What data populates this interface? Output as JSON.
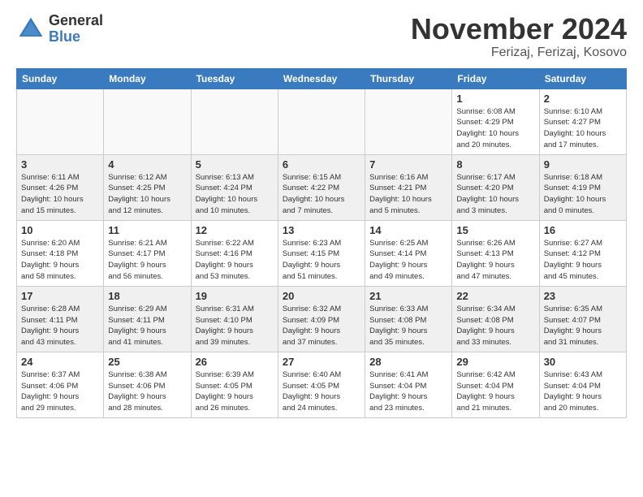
{
  "header": {
    "logo_general": "General",
    "logo_blue": "Blue",
    "month_title": "November 2024",
    "location": "Ferizaj, Ferizaj, Kosovo"
  },
  "days_of_week": [
    "Sunday",
    "Monday",
    "Tuesday",
    "Wednesday",
    "Thursday",
    "Friday",
    "Saturday"
  ],
  "weeks": [
    [
      {
        "day": "",
        "info": "",
        "empty": true
      },
      {
        "day": "",
        "info": "",
        "empty": true
      },
      {
        "day": "",
        "info": "",
        "empty": true
      },
      {
        "day": "",
        "info": "",
        "empty": true
      },
      {
        "day": "",
        "info": "",
        "empty": true
      },
      {
        "day": "1",
        "info": "Sunrise: 6:08 AM\nSunset: 4:29 PM\nDaylight: 10 hours\nand 20 minutes.",
        "empty": false
      },
      {
        "day": "2",
        "info": "Sunrise: 6:10 AM\nSunset: 4:27 PM\nDaylight: 10 hours\nand 17 minutes.",
        "empty": false
      }
    ],
    [
      {
        "day": "3",
        "info": "Sunrise: 6:11 AM\nSunset: 4:26 PM\nDaylight: 10 hours\nand 15 minutes.",
        "empty": false
      },
      {
        "day": "4",
        "info": "Sunrise: 6:12 AM\nSunset: 4:25 PM\nDaylight: 10 hours\nand 12 minutes.",
        "empty": false
      },
      {
        "day": "5",
        "info": "Sunrise: 6:13 AM\nSunset: 4:24 PM\nDaylight: 10 hours\nand 10 minutes.",
        "empty": false
      },
      {
        "day": "6",
        "info": "Sunrise: 6:15 AM\nSunset: 4:22 PM\nDaylight: 10 hours\nand 7 minutes.",
        "empty": false
      },
      {
        "day": "7",
        "info": "Sunrise: 6:16 AM\nSunset: 4:21 PM\nDaylight: 10 hours\nand 5 minutes.",
        "empty": false
      },
      {
        "day": "8",
        "info": "Sunrise: 6:17 AM\nSunset: 4:20 PM\nDaylight: 10 hours\nand 3 minutes.",
        "empty": false
      },
      {
        "day": "9",
        "info": "Sunrise: 6:18 AM\nSunset: 4:19 PM\nDaylight: 10 hours\nand 0 minutes.",
        "empty": false
      }
    ],
    [
      {
        "day": "10",
        "info": "Sunrise: 6:20 AM\nSunset: 4:18 PM\nDaylight: 9 hours\nand 58 minutes.",
        "empty": false
      },
      {
        "day": "11",
        "info": "Sunrise: 6:21 AM\nSunset: 4:17 PM\nDaylight: 9 hours\nand 56 minutes.",
        "empty": false
      },
      {
        "day": "12",
        "info": "Sunrise: 6:22 AM\nSunset: 4:16 PM\nDaylight: 9 hours\nand 53 minutes.",
        "empty": false
      },
      {
        "day": "13",
        "info": "Sunrise: 6:23 AM\nSunset: 4:15 PM\nDaylight: 9 hours\nand 51 minutes.",
        "empty": false
      },
      {
        "day": "14",
        "info": "Sunrise: 6:25 AM\nSunset: 4:14 PM\nDaylight: 9 hours\nand 49 minutes.",
        "empty": false
      },
      {
        "day": "15",
        "info": "Sunrise: 6:26 AM\nSunset: 4:13 PM\nDaylight: 9 hours\nand 47 minutes.",
        "empty": false
      },
      {
        "day": "16",
        "info": "Sunrise: 6:27 AM\nSunset: 4:12 PM\nDaylight: 9 hours\nand 45 minutes.",
        "empty": false
      }
    ],
    [
      {
        "day": "17",
        "info": "Sunrise: 6:28 AM\nSunset: 4:11 PM\nDaylight: 9 hours\nand 43 minutes.",
        "empty": false
      },
      {
        "day": "18",
        "info": "Sunrise: 6:29 AM\nSunset: 4:11 PM\nDaylight: 9 hours\nand 41 minutes.",
        "empty": false
      },
      {
        "day": "19",
        "info": "Sunrise: 6:31 AM\nSunset: 4:10 PM\nDaylight: 9 hours\nand 39 minutes.",
        "empty": false
      },
      {
        "day": "20",
        "info": "Sunrise: 6:32 AM\nSunset: 4:09 PM\nDaylight: 9 hours\nand 37 minutes.",
        "empty": false
      },
      {
        "day": "21",
        "info": "Sunrise: 6:33 AM\nSunset: 4:08 PM\nDaylight: 9 hours\nand 35 minutes.",
        "empty": false
      },
      {
        "day": "22",
        "info": "Sunrise: 6:34 AM\nSunset: 4:08 PM\nDaylight: 9 hours\nand 33 minutes.",
        "empty": false
      },
      {
        "day": "23",
        "info": "Sunrise: 6:35 AM\nSunset: 4:07 PM\nDaylight: 9 hours\nand 31 minutes.",
        "empty": false
      }
    ],
    [
      {
        "day": "24",
        "info": "Sunrise: 6:37 AM\nSunset: 4:06 PM\nDaylight: 9 hours\nand 29 minutes.",
        "empty": false
      },
      {
        "day": "25",
        "info": "Sunrise: 6:38 AM\nSunset: 4:06 PM\nDaylight: 9 hours\nand 28 minutes.",
        "empty": false
      },
      {
        "day": "26",
        "info": "Sunrise: 6:39 AM\nSunset: 4:05 PM\nDaylight: 9 hours\nand 26 minutes.",
        "empty": false
      },
      {
        "day": "27",
        "info": "Sunrise: 6:40 AM\nSunset: 4:05 PM\nDaylight: 9 hours\nand 24 minutes.",
        "empty": false
      },
      {
        "day": "28",
        "info": "Sunrise: 6:41 AM\nSunset: 4:04 PM\nDaylight: 9 hours\nand 23 minutes.",
        "empty": false
      },
      {
        "day": "29",
        "info": "Sunrise: 6:42 AM\nSunset: 4:04 PM\nDaylight: 9 hours\nand 21 minutes.",
        "empty": false
      },
      {
        "day": "30",
        "info": "Sunrise: 6:43 AM\nSunset: 4:04 PM\nDaylight: 9 hours\nand 20 minutes.",
        "empty": false
      }
    ]
  ]
}
